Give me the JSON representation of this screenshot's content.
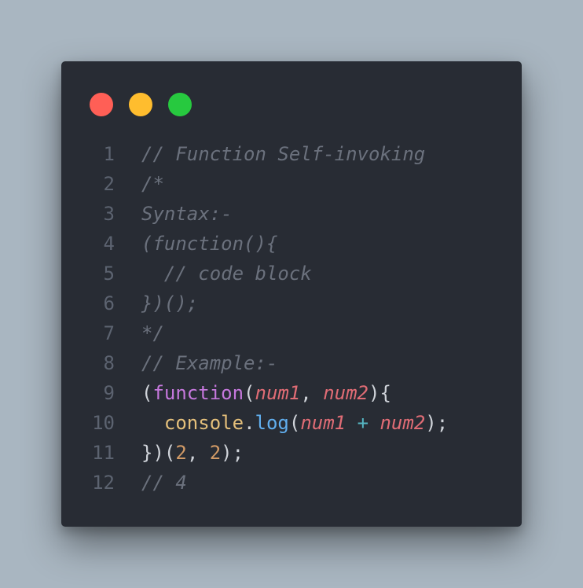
{
  "window": {
    "controls": {
      "close_color": "#ff5f56",
      "minimize_color": "#ffbd2e",
      "maximize_color": "#27c93f"
    }
  },
  "editor": {
    "language": "javascript",
    "lines": [
      {
        "number": "1",
        "tokens": [
          {
            "text": "// Function Self-invoking",
            "type": "comment"
          }
        ]
      },
      {
        "number": "2",
        "tokens": [
          {
            "text": "/*",
            "type": "comment"
          }
        ]
      },
      {
        "number": "3",
        "tokens": [
          {
            "text": "Syntax:-",
            "type": "comment"
          }
        ]
      },
      {
        "number": "4",
        "tokens": [
          {
            "text": "(function(){",
            "type": "comment"
          }
        ]
      },
      {
        "number": "5",
        "tokens": [
          {
            "text": "  // code block",
            "type": "comment"
          }
        ]
      },
      {
        "number": "6",
        "tokens": [
          {
            "text": "})();",
            "type": "comment"
          }
        ]
      },
      {
        "number": "7",
        "tokens": [
          {
            "text": "*/",
            "type": "comment"
          }
        ]
      },
      {
        "number": "8",
        "tokens": [
          {
            "text": "// Example:-",
            "type": "comment"
          }
        ]
      },
      {
        "number": "9",
        "tokens": [
          {
            "text": "(",
            "type": "punct"
          },
          {
            "text": "function",
            "type": "keyword"
          },
          {
            "text": "(",
            "type": "punct"
          },
          {
            "text": "num1",
            "type": "param"
          },
          {
            "text": ", ",
            "type": "punct"
          },
          {
            "text": "num2",
            "type": "param"
          },
          {
            "text": "){",
            "type": "punct"
          }
        ]
      },
      {
        "number": "10",
        "tokens": [
          {
            "text": "  ",
            "type": "punct"
          },
          {
            "text": "console",
            "type": "ident"
          },
          {
            "text": ".",
            "type": "punct"
          },
          {
            "text": "log",
            "type": "method"
          },
          {
            "text": "(",
            "type": "punct"
          },
          {
            "text": "num1",
            "type": "param"
          },
          {
            "text": " + ",
            "type": "op"
          },
          {
            "text": "num2",
            "type": "param"
          },
          {
            "text": ");",
            "type": "punct"
          }
        ]
      },
      {
        "number": "11",
        "tokens": [
          {
            "text": "})(",
            "type": "punct"
          },
          {
            "text": "2",
            "type": "number"
          },
          {
            "text": ", ",
            "type": "punct"
          },
          {
            "text": "2",
            "type": "number"
          },
          {
            "text": ");",
            "type": "punct"
          }
        ]
      },
      {
        "number": "12",
        "tokens": [
          {
            "text": "// 4",
            "type": "comment"
          }
        ]
      }
    ]
  }
}
